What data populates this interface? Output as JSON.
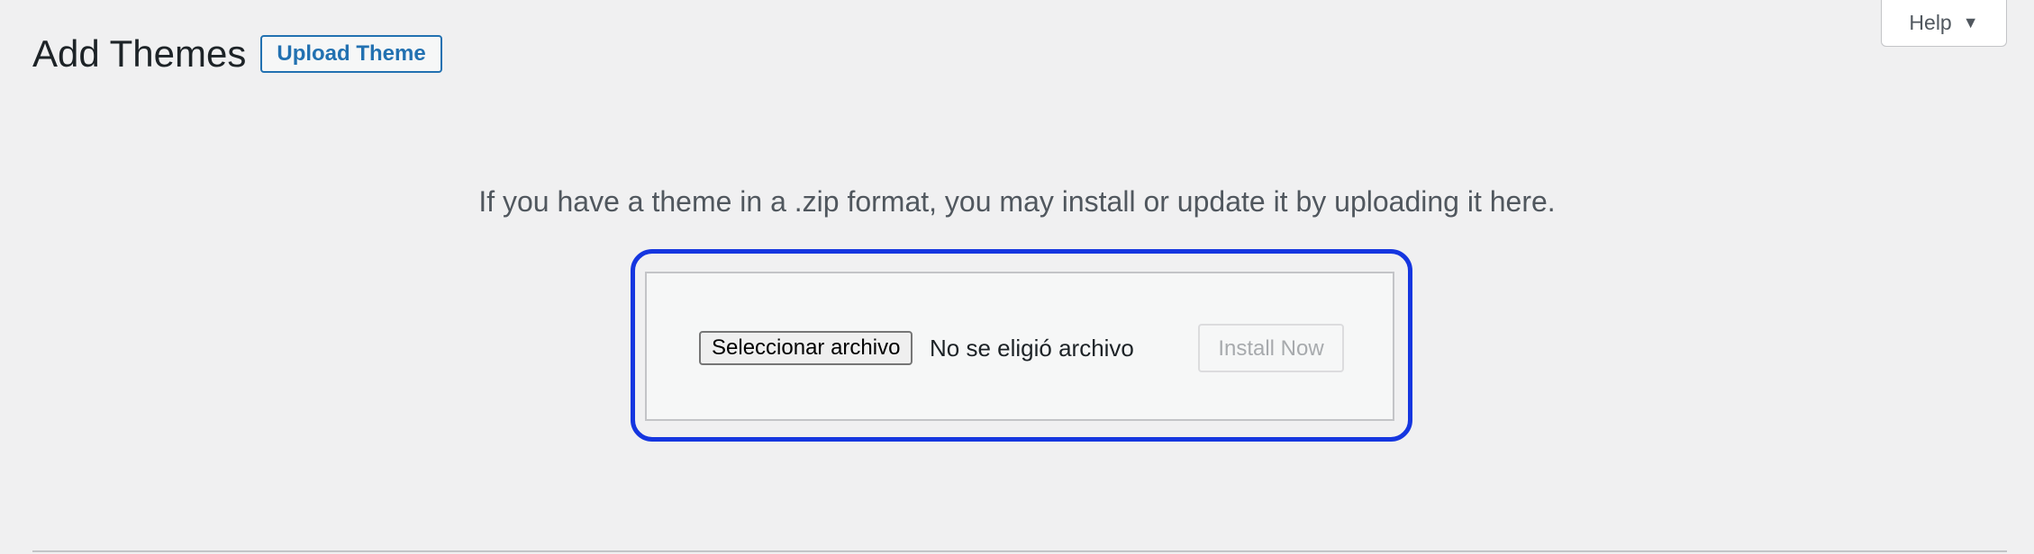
{
  "header": {
    "title": "Add Themes",
    "upload_theme_label": "Upload Theme"
  },
  "help": {
    "label": "Help",
    "icon": "triangle-down-icon"
  },
  "upload": {
    "intro": "If you have a theme in a .zip format, you may install or update it by uploading it here.",
    "file_button_label": "Seleccionar archivo",
    "file_status": "No se eligió archivo",
    "install_label": "Install Now",
    "install_disabled": true
  },
  "colors": {
    "accent": "#2271b1",
    "highlight": "#1536e0",
    "background": "#f0f0f1"
  }
}
